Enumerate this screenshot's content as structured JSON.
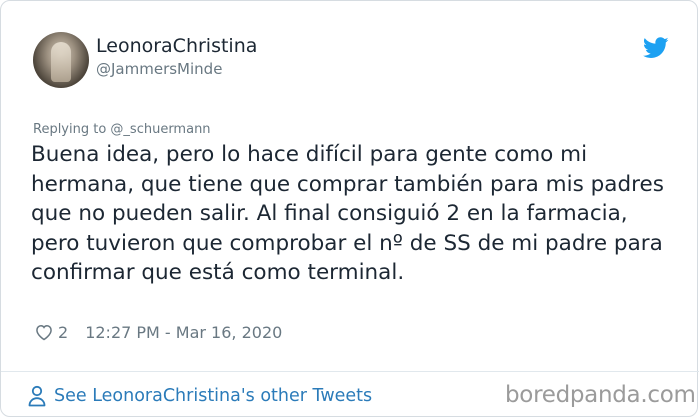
{
  "tweet": {
    "author": {
      "display_name": "LeonoraChristina",
      "handle": "@JammersMinde"
    },
    "reply_context": "Replying to @_schuermann",
    "text": "Buena idea, pero lo hace difícil para gente como mi hermana, que tiene que comprar también para mis padres que no pueden salir. Al final consiguió 2 en la farmacia, pero tuvieron que comprobar el nº de SS de mi padre para confirmar que está como terminal.",
    "like_count": "2",
    "timestamp": "12:27 PM - Mar 16, 2020",
    "see_more_label": "See LeonoraChristina's other Tweets"
  },
  "watermark": "boredpanda.com",
  "icons": {
    "brand": "twitter-bird-icon",
    "like": "heart-icon",
    "profile": "person-icon"
  },
  "colors": {
    "twitter_blue": "#1da1f2",
    "link": "#2b7bb9",
    "text": "#1c2733",
    "muted": "#697882"
  }
}
